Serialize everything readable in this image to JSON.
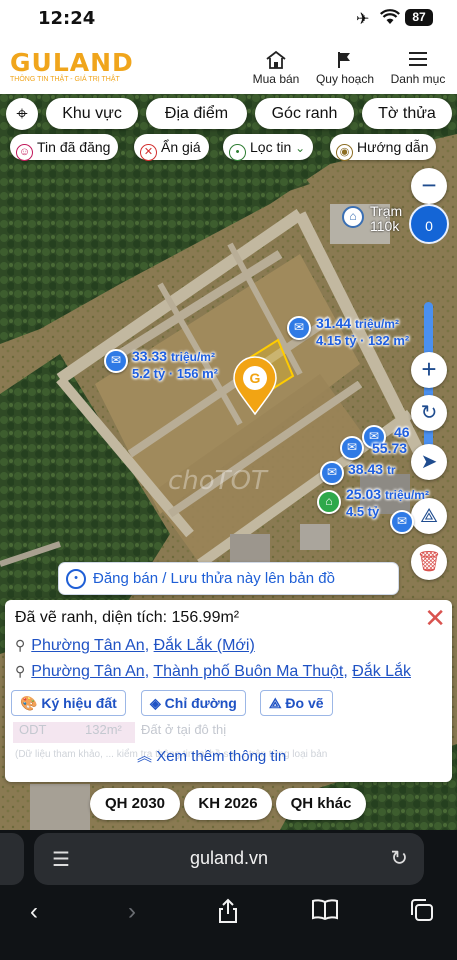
{
  "status": {
    "time": "12:24",
    "battery": "87"
  },
  "header": {
    "logo": "GULAND",
    "tagline": "THÔNG TIN THẬT - GIÁ TRỊ THẬT",
    "nav": [
      {
        "label": "Mua bán",
        "icon": "house-icon"
      },
      {
        "label": "Quy hoạch",
        "icon": "map-flag-icon"
      },
      {
        "label": "Danh mục",
        "icon": "menu-icon"
      }
    ]
  },
  "map": {
    "search_tabs": [
      "Khu vực",
      "Địa điểm",
      "Góc ranh",
      "Tờ thửa"
    ],
    "chips": [
      {
        "label": "Tin đã đăng",
        "icon": "posted-icon"
      },
      {
        "label": "Ẩn giá",
        "icon": "hide-price-icon"
      },
      {
        "label": "Lọc tin",
        "icon": "filter-pin-icon"
      },
      {
        "label": "Hướng dẫn",
        "icon": "guide-icon"
      }
    ],
    "zoom_value": "0",
    "poi_label": "Trạm\n110k",
    "watermark": "choTOT",
    "listings": [
      {
        "price": "33.33",
        "unit": "triệu/m²",
        "sub": "5.2 tỷ · 156 m²"
      },
      {
        "price": "31.44",
        "unit": "triệu/m²",
        "sub": "4.15 tỷ · 132 m²"
      },
      {
        "price": "38.43",
        "unit": "tr",
        "sub": ""
      },
      {
        "price": "25.03",
        "unit": "triệu/m²",
        "sub": "4.5 tỷ"
      },
      {
        "price": "46",
        "unit": "",
        "sub": ""
      },
      {
        "price": "55.73",
        "unit": "",
        "sub": ""
      }
    ],
    "post_button": "Đăng bán / Lưu thửa này lên bản đồ",
    "info": {
      "title": "Đã vẽ ranh, diện tích: 156.99m²",
      "loc1": {
        "ward": "Phường Tân An",
        "province": "Đắk Lắk (Mới)"
      },
      "loc2": {
        "ward": "Phường Tân An",
        "city": "Thành phố Buôn Ma Thuột",
        "province": "Đắk Lắk"
      },
      "buttons": [
        "Ký hiệu đất",
        "Chỉ đường",
        "Đo vẽ"
      ],
      "land_code": "ODT",
      "land_area": "132m²",
      "land_desc": "Đất ở tại đô thị",
      "disclaimer": "(Dữ liệu tham khảo, ... kiểm tra thông tin tại hồ sơ ... trên từng loại bản",
      "more": "Xem thêm thông tin"
    },
    "plan_buttons": [
      "QH 2030",
      "KH 2026",
      "QH khác"
    ]
  },
  "browser": {
    "url": "guland.vn"
  }
}
